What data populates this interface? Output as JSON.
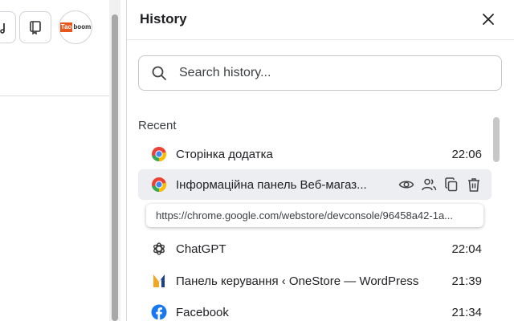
{
  "toolbar": {
    "avatar_logo_part1": "Tao",
    "avatar_logo_part2": "boom"
  },
  "panel": {
    "title": "History",
    "search": {
      "placeholder": "Search history...",
      "value": ""
    },
    "section_label": "Recent",
    "items": [
      {
        "title": "Сторінка додатка",
        "time": "22:06",
        "favicon": "chrome-icon"
      },
      {
        "title": "Інформаційна панель Веб-магаз...",
        "time": "",
        "favicon": "chrome-icon",
        "hovered": true
      },
      {
        "title": "ChatGPT",
        "time": "22:04",
        "favicon": "openai-icon"
      },
      {
        "title": "Панель керування ‹ OneStore — WordPress",
        "time": "21:39",
        "favicon": "onestore-icon"
      },
      {
        "title": "Facebook",
        "time": "21:34",
        "favicon": "facebook-icon"
      }
    ],
    "tooltip_url": "https://chrome.google.com/webstore/devconsole/96458a42-1a...",
    "hover_actions": [
      "eye-icon",
      "people-icon",
      "copy-icon",
      "trash-icon"
    ]
  },
  "colors": {
    "chrome_red": "#ea4335",
    "chrome_yellow": "#fbbc04",
    "chrome_green": "#34a853",
    "chrome_blue": "#4285f4",
    "facebook_blue": "#1877f2",
    "logo_orange": "#e8561c",
    "hover_row": "#eceef1"
  }
}
